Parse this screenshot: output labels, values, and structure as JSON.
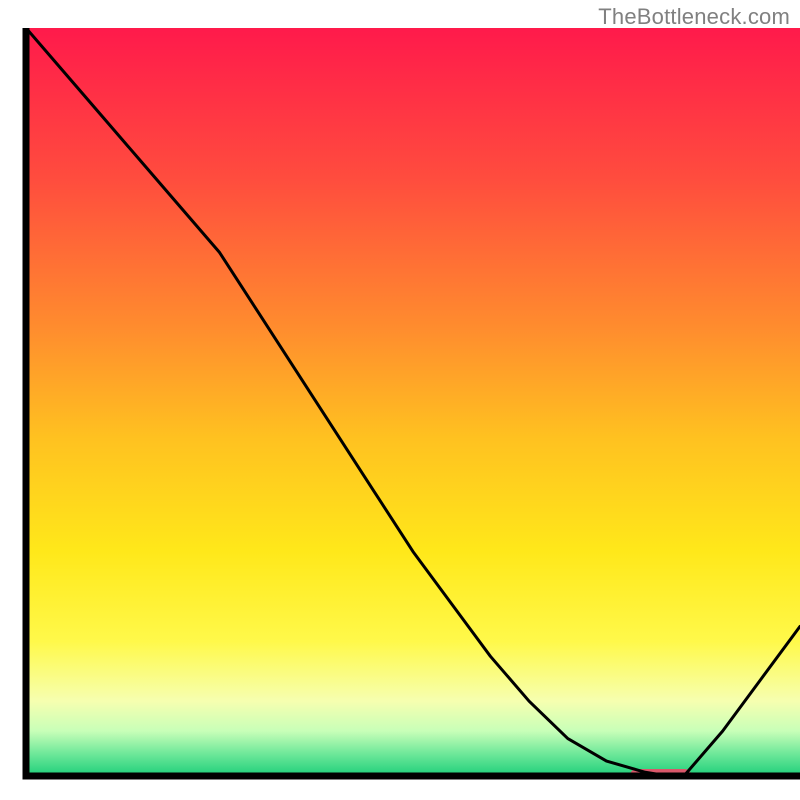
{
  "watermark": "TheBottleneck.com",
  "chart_data": {
    "type": "line",
    "title": "",
    "xlabel": "",
    "ylabel": "",
    "xlim": [
      0,
      100
    ],
    "ylim": [
      0,
      100
    ],
    "x": [
      0,
      5,
      10,
      15,
      20,
      25,
      30,
      35,
      40,
      45,
      50,
      55,
      60,
      65,
      70,
      75,
      80,
      83,
      85,
      90,
      95,
      100
    ],
    "values": [
      100,
      94,
      88,
      82,
      76,
      70,
      62,
      54,
      46,
      38,
      30,
      23,
      16,
      10,
      5,
      2,
      0.5,
      0,
      0,
      6,
      13,
      20
    ],
    "marker": {
      "x_start": 78,
      "x_end": 86,
      "y": 0
    },
    "gradient_stops": [
      {
        "offset": 0.0,
        "color": "#ff1a4b"
      },
      {
        "offset": 0.2,
        "color": "#ff4c3e"
      },
      {
        "offset": 0.4,
        "color": "#ff8c2e"
      },
      {
        "offset": 0.55,
        "color": "#ffc220"
      },
      {
        "offset": 0.7,
        "color": "#ffe81a"
      },
      {
        "offset": 0.82,
        "color": "#fff94a"
      },
      {
        "offset": 0.9,
        "color": "#f6ffb0"
      },
      {
        "offset": 0.94,
        "color": "#c8ffb8"
      },
      {
        "offset": 0.97,
        "color": "#6fe89a"
      },
      {
        "offset": 1.0,
        "color": "#1ecf7a"
      }
    ],
    "marker_color": "#d9586a",
    "axis_color": "#000000",
    "axis_width": 7,
    "line_color": "#000000",
    "line_width": 3
  }
}
